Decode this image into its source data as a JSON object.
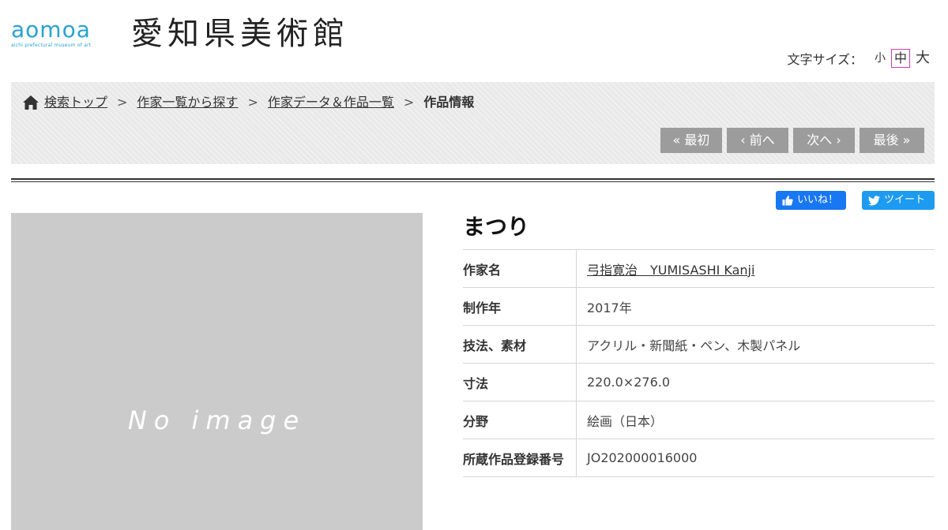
{
  "header": {
    "logo_text": "aomoa",
    "logo_sub": "aichi prefectural museum of art",
    "site_name": "愛知県美術館",
    "brand_color": "#27a3cf"
  },
  "font_size": {
    "label": "文字サイズ：",
    "small": "小",
    "medium": "中",
    "large": "大",
    "selected": "中"
  },
  "breadcrumb": {
    "items": [
      "検索トップ",
      "作家一覧から探す",
      "作家データ＆作品一覧"
    ],
    "current": "作品情報",
    "separator": ">"
  },
  "pager": {
    "first": "« 最初",
    "prev": "‹ 前へ",
    "next": "次へ ›",
    "last": "最後 »"
  },
  "social": {
    "like": "いいね！",
    "tweet": "ツイート"
  },
  "image": {
    "placeholder": "No image"
  },
  "work": {
    "title": "まつり",
    "rows": [
      {
        "label": "作家名",
        "value": "弓指寛治　YUMISASHI Kanji"
      },
      {
        "label": "制作年",
        "value": "2017年"
      },
      {
        "label": "技法、素材",
        "value": "アクリル・新聞紙・ペン、木製パネル"
      },
      {
        "label": "寸法",
        "value": "220.0×276.0"
      },
      {
        "label": "分野",
        "value": "絵画（日本）"
      },
      {
        "label": "所蔵作品登録番号",
        "value": "JO202000016000"
      }
    ]
  }
}
